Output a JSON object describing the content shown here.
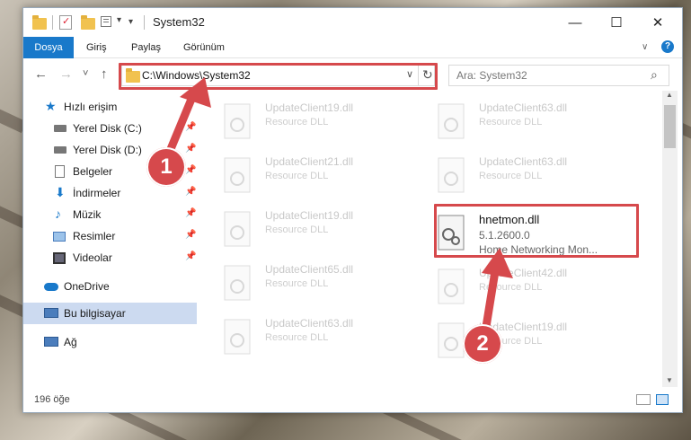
{
  "window": {
    "title": "System32",
    "minimize_glyph": "—",
    "maximize_glyph": "☐",
    "close_glyph": "✕"
  },
  "ribbon": {
    "tabs": [
      {
        "label": "Dosya",
        "active": true
      },
      {
        "label": "Giriş",
        "active": false
      },
      {
        "label": "Paylaş",
        "active": false
      },
      {
        "label": "Görünüm",
        "active": false
      }
    ],
    "collapse_glyph": "∨",
    "help_glyph": "?"
  },
  "address": {
    "path": "C:\\Windows\\System32",
    "search_placeholder": "Ara: System32"
  },
  "nav": {
    "back_glyph": "←",
    "forward_glyph": "→",
    "recent_glyph": "˅",
    "up_glyph": "↑",
    "quick_access": "Hızlı erişim",
    "items": [
      {
        "label": "Yerel Disk (C:)",
        "icon": "drive-icon",
        "pinned": true
      },
      {
        "label": "Yerel Disk (D:)",
        "icon": "drive-icon",
        "pinned": true
      },
      {
        "label": "Belgeler",
        "icon": "document-icon",
        "pinned": true
      },
      {
        "label": "İndirmeler",
        "icon": "download-icon",
        "pinned": true
      },
      {
        "label": "Müzik",
        "icon": "music-icon",
        "pinned": true
      },
      {
        "label": "Resimler",
        "icon": "picture-icon",
        "pinned": true
      },
      {
        "label": "Videolar",
        "icon": "video-icon",
        "pinned": true
      }
    ],
    "onedrive": "OneDrive",
    "this_pc": "Bu bilgisayar",
    "network": "Ağ"
  },
  "files": {
    "left_column": [
      {
        "name": "UpdateClient19.dll",
        "desc": "Resource DLL"
      },
      {
        "name": "UpdateClient21.dll",
        "desc": "Resource DLL"
      },
      {
        "name": "UpdateClient19.dll",
        "desc": "Resource DLL"
      },
      {
        "name": "UpdateClient65.dll",
        "desc": "Resource DLL"
      },
      {
        "name": "UpdateClient63.dll",
        "desc": "Resource DLL"
      }
    ],
    "right_column": [
      {
        "name": "UpdateClient63.dll",
        "desc": "Resource DLL"
      },
      {
        "name": "UpdateClient63.dll",
        "desc": "Resource DLL"
      },
      {
        "name": "UpdateClient42.dll",
        "desc": "Resource DLL"
      },
      {
        "name": "UpdateClient19.dll",
        "desc": "Resource DLL"
      }
    ],
    "featured": {
      "name": "hnetmon.dll",
      "version": "5.1.2600.0",
      "description": "Home Networking Mon..."
    }
  },
  "status": {
    "count": "196 öğe"
  },
  "annotations": {
    "step1": "1",
    "step2": "2",
    "color": "#d6494c"
  }
}
